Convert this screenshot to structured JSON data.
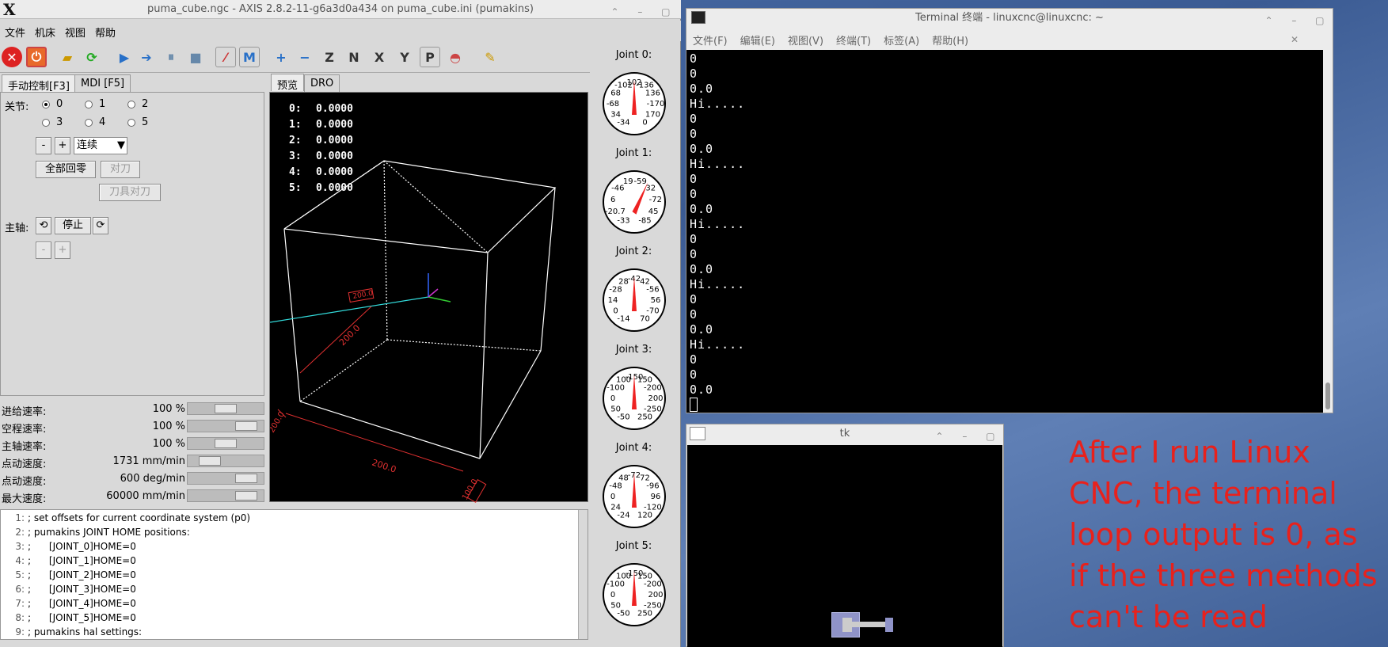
{
  "axis": {
    "title": "puma_cube.ngc - AXIS 2.8.2-11-g6a3d0a434 on puma_cube.ini (pumakins)",
    "logo": "X",
    "menu": [
      "文件",
      "机床",
      "视图",
      "帮助"
    ],
    "tabs_left": [
      "手动控制[F3]",
      "MDI [F5]"
    ],
    "tabs_right": [
      "预览",
      "DRO"
    ],
    "manual": {
      "joint_label": "关节:",
      "joints": [
        "0",
        "1",
        "2",
        "3",
        "4",
        "5"
      ],
      "selected_joint": "0",
      "minus": "-",
      "plus": "+",
      "jog_mode": "连续",
      "home_all": "全部回零",
      "touch_off": "对刀",
      "tool_touch_off": "刀具对刀",
      "spindle_label": "主轴:",
      "spindle_stop": "停止",
      "spindle_minus": "-",
      "spindle_plus": "+"
    },
    "overrides": [
      {
        "label": "进给速率:",
        "value": "100 %",
        "level": 0.5
      },
      {
        "label": "空程速率:",
        "value": "100 %",
        "level": 0.88
      },
      {
        "label": "主轴速率:",
        "value": "100 %",
        "level": 0.5
      },
      {
        "label": "点动速度:",
        "value": "1731 mm/min",
        "level": 0.2
      },
      {
        "label": "点动速度:",
        "value": "600 deg/min",
        "level": 0.88
      },
      {
        "label": "最大速度:",
        "value": "60000 mm/min",
        "level": 0.88
      }
    ],
    "dro": [
      {
        "axis": "0:",
        "value": "0.0000"
      },
      {
        "axis": "1:",
        "value": "0.0000"
      },
      {
        "axis": "2:",
        "value": "0.0000"
      },
      {
        "axis": "3:",
        "value": "0.0000"
      },
      {
        "axis": "4:",
        "value": "0.0000"
      },
      {
        "axis": "5:",
        "value": "0.0000"
      }
    ],
    "preview_dims": [
      "200.0",
      "200.0",
      "100.0",
      "200.0",
      "200.0"
    ],
    "gcode": [
      {
        "n": "1:",
        "text": "; set offsets for current coordinate system (p0)"
      },
      {
        "n": "2:",
        "text": "; pumakins JOINT HOME positions:"
      },
      {
        "n": "3:",
        "text": ";      [JOINT_0]HOME=0"
      },
      {
        "n": "4:",
        "text": ";      [JOINT_1]HOME=0"
      },
      {
        "n": "5:",
        "text": ";      [JOINT_2]HOME=0"
      },
      {
        "n": "6:",
        "text": ";      [JOINT_3]HOME=0"
      },
      {
        "n": "7:",
        "text": ";      [JOINT_4]HOME=0"
      },
      {
        "n": "8:",
        "text": ";      [JOINT_5]HOME=0"
      },
      {
        "n": "9:",
        "text": "; pumakins hal settings:"
      }
    ],
    "gauges": [
      {
        "label": "Joint 0:",
        "ticks": [
          "-34",
          "34",
          "-68",
          "68",
          "-102",
          "102",
          "-136",
          "136",
          "-170",
          "170",
          "0"
        ]
      },
      {
        "label": "Joint 1:",
        "ticks": [
          "-33",
          "-20.7",
          "6",
          "-46",
          "19",
          "-59",
          "32",
          "-72",
          "45",
          "-85"
        ]
      },
      {
        "label": "Joint 2:",
        "ticks": [
          "-14",
          "0",
          "14",
          "-28",
          "28",
          "-42",
          "42",
          "-56",
          "56",
          "-70",
          "70"
        ]
      },
      {
        "label": "Joint 3:",
        "ticks": [
          "-50",
          "50",
          "0",
          "-100",
          "100",
          "-150",
          "150",
          "-200",
          "200",
          "-250",
          "250"
        ]
      },
      {
        "label": "Joint 4:",
        "ticks": [
          "-24",
          "24",
          "0",
          "-48",
          "48",
          "-72",
          "72",
          "-96",
          "96",
          "-120",
          "120"
        ]
      },
      {
        "label": "Joint 5:",
        "ticks": [
          "-50",
          "50",
          "0",
          "-100",
          "100",
          "-150",
          "150",
          "-200",
          "200",
          "-250",
          "250"
        ]
      }
    ]
  },
  "terminal": {
    "title": "Terminal 终端 - linuxcnc@linuxcnc: ~",
    "menu": [
      "文件(F)",
      "编辑(E)",
      "视图(V)",
      "终端(T)",
      "标签(A)",
      "帮助(H)"
    ],
    "lines": [
      "0",
      "0",
      "0.0",
      "Hi.....",
      "0",
      "0",
      "0.0",
      "Hi.....",
      "0",
      "0",
      "0.0",
      "Hi.....",
      "0",
      "0",
      "0.0",
      "Hi.....",
      "0",
      "0",
      "0.0",
      "Hi.....",
      "0",
      "0",
      "0.0"
    ]
  },
  "tk": {
    "title": "tk"
  },
  "annotation": "After I run Linux CNC, the terminal loop output is 0, as if the three methods can't be read",
  "colors": {
    "annotation": "#e8211c",
    "preview_bg": "#000000",
    "terminal_bg": "#000000",
    "dim_red": "#e03030"
  }
}
